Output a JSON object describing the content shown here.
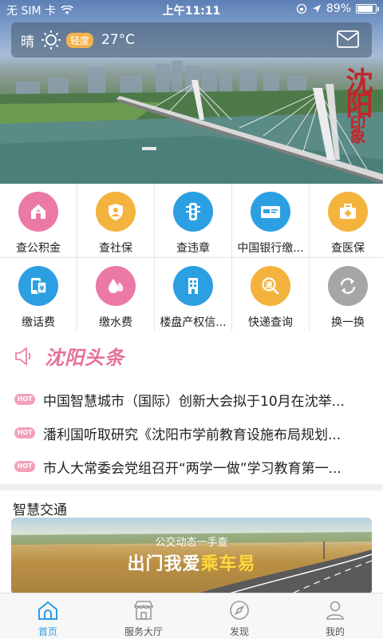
{
  "status_bar": {
    "carrier": "无 SIM 卡",
    "time": "上午11:11",
    "battery": "89%",
    "battery_level": 0.89
  },
  "weather": {
    "condition": "晴",
    "air_quality": "轻度",
    "temperature": "27°C"
  },
  "banner_calligraphy": {
    "main": "沈阳",
    "seal": "印象"
  },
  "services": [
    {
      "label": "查公积金",
      "icon": "house-icon",
      "color": "#ea7aa5"
    },
    {
      "label": "查社保",
      "icon": "shield-person-icon",
      "color": "#f3b33d"
    },
    {
      "label": "查违章",
      "icon": "traffic-light-icon",
      "color": "#2c9fe3"
    },
    {
      "label": "中国银行缴...",
      "icon": "bank-card-icon",
      "color": "#2c9fe3"
    },
    {
      "label": "查医保",
      "icon": "medical-kit-icon",
      "color": "#f3b33d"
    },
    {
      "label": "缴话费",
      "icon": "phone-icon",
      "color": "#2c9fe3"
    },
    {
      "label": "缴水费",
      "icon": "water-drop-icon",
      "color": "#ea7aa5"
    },
    {
      "label": "楼盘产权信...",
      "icon": "building-icon",
      "color": "#2c9fe3"
    },
    {
      "label": "快递查询",
      "icon": "express-search-icon",
      "color": "#f3b33d"
    },
    {
      "label": "换一换",
      "icon": "refresh-icon",
      "color": "#999999"
    }
  ],
  "headlines": {
    "title": "沈阳头条",
    "badge": "HOT",
    "items": [
      "中国智慧城市（国际）创新大会拟于10月在沈举...",
      "潘利国听取研究《沈阳市学前教育设施布局规划...",
      "市人大常委会党组召开“两学一做”学习教育第一..."
    ]
  },
  "traffic": {
    "title": "智慧交通",
    "banner_sub": "公交动态一手查",
    "banner_main_a": "出门我爱",
    "banner_main_b": "乘车易"
  },
  "tabbar": {
    "tabs": [
      {
        "label": "首页",
        "icon": "home-icon"
      },
      {
        "label": "服务大厅",
        "icon": "store-icon"
      },
      {
        "label": "发现",
        "icon": "compass-icon"
      },
      {
        "label": "我的",
        "icon": "user-icon"
      }
    ]
  },
  "colors": {
    "accent": "#2b9be6",
    "pink": "#e8709c",
    "hot": "#f2a0b8"
  }
}
